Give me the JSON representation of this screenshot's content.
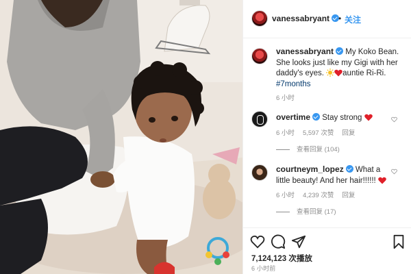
{
  "post": {
    "username": "vanessabryant",
    "follow_label": "关注",
    "separator": "•",
    "caption": {
      "username": "vanessabryant",
      "text_1": " My Koko Bean. She looks just like my Gigi with her daddy's eyes. ",
      "text_2": "auntie Ri-Ri.",
      "hashtag": "#7months",
      "time": "6 小时"
    },
    "comments": [
      {
        "username": "overtime",
        "text": " Stay strong ",
        "time": "6 小时",
        "likes": "5,597 次赞",
        "reply": "回复",
        "view_replies": "查看回复 (104)"
      },
      {
        "username": "courtneym_lopez",
        "text": " What a little beauty! And her hair!!!!!! ",
        "time": "6 小时",
        "likes": "4,239 次赞",
        "reply": "回复",
        "view_replies": "查看回复 (17)"
      }
    ],
    "views": "7,124,123 次播放",
    "posted_ago": "6 小时前",
    "icons": [
      "heart-icon",
      "comment-icon",
      "share-icon",
      "bookmark-icon",
      "verified-badge-icon",
      "red-heart-emoji",
      "sun-emoji"
    ],
    "colors": {
      "accent": "#3897f0",
      "hashtag": "#00376b",
      "meta": "#8e8e8e",
      "heart": "#ed4956"
    }
  }
}
